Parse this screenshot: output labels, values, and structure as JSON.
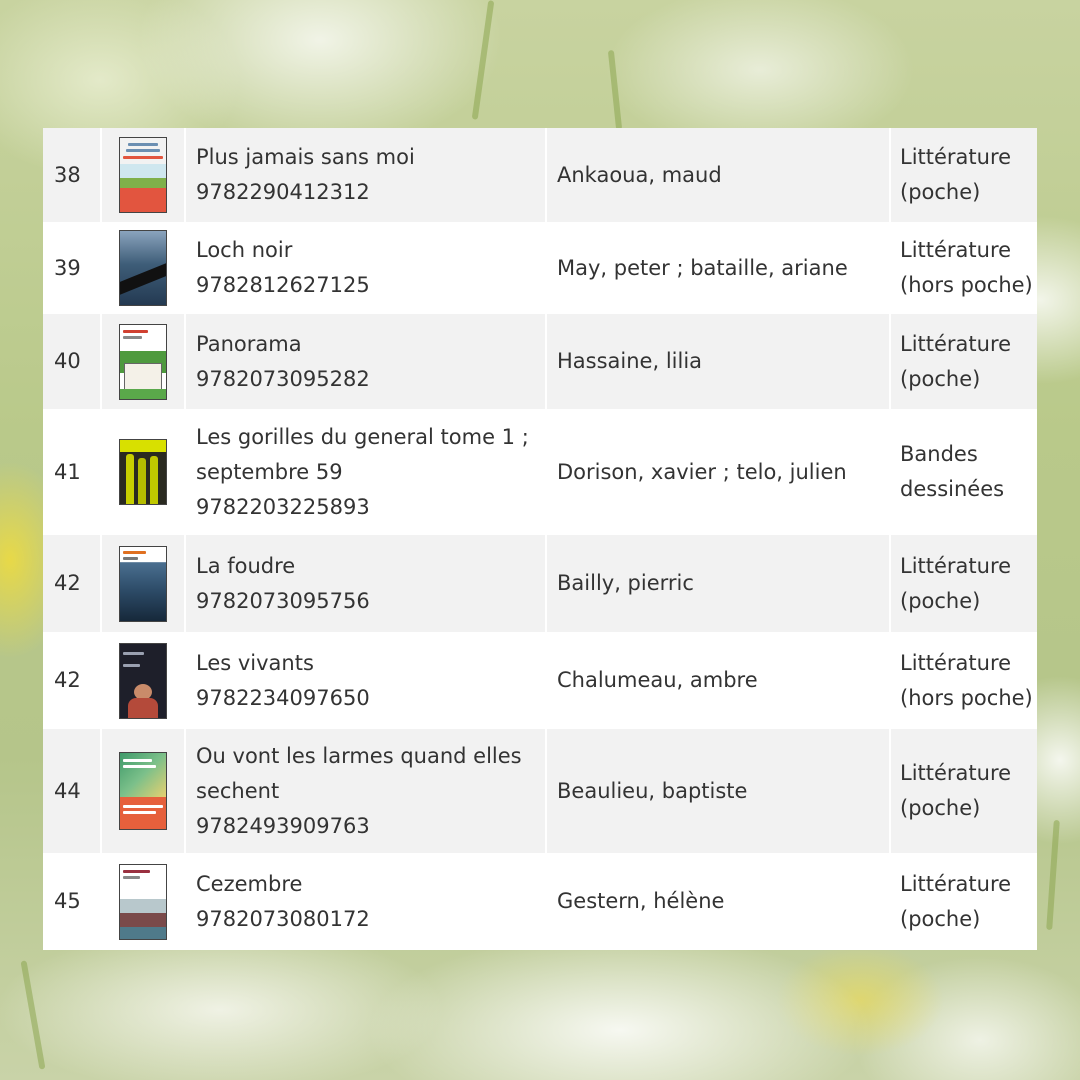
{
  "books": [
    {
      "rank": "38",
      "title": "Plus jamais sans moi",
      "isbn": "9782290412312",
      "author": "Ankaoua, maud",
      "category_line1": "Littérature",
      "category_line2": "(poche)",
      "cover_bg": "#cfe7ef",
      "cover_accent": "#e2553f",
      "cover_top": "#f2f6f3",
      "cover_band": "#7fb04a"
    },
    {
      "rank": "39",
      "title": "Loch noir",
      "isbn": "9782812627125",
      "author": "May, peter ; bataille, ariane",
      "category_line1": "Littérature",
      "category_line2": "(hors poche)",
      "cover_bg": "#3e5d78",
      "cover_accent": "#111111",
      "cover_top": "#8aa3bd",
      "cover_band": "#1a1a1a"
    },
    {
      "rank": "40",
      "title": "Panorama",
      "isbn": "9782073095282",
      "author": "Hassaine, lilia",
      "category_line1": "Littérature",
      "category_line2": "(poche)",
      "cover_bg": "#ffffff",
      "cover_accent": "#3a8a3a",
      "cover_top": "#ffffff",
      "cover_band": "#5aa84a"
    },
    {
      "rank": "41",
      "title_line1": "Les gorilles du general tome 1 ;",
      "title_line2": "septembre 59",
      "isbn": "9782203225893",
      "author": "Dorison, xavier ; telo, julien",
      "category_line1": "Bandes",
      "category_line2": "dessinées",
      "cover_bg": "#2a2a20",
      "cover_accent": "#d8e000",
      "cover_top": "#d8e000",
      "cover_band": "#444433"
    },
    {
      "rank": "42",
      "title": "La foudre",
      "isbn": "9782073095756",
      "author": "Bailly, pierric",
      "category_line1": "Littérature",
      "category_line2": "(poche)",
      "cover_bg": "#2c4a66",
      "cover_accent": "#e07020",
      "cover_top": "#ffffff",
      "cover_band": "#16283a"
    },
    {
      "rank": "42",
      "title": "Les vivants",
      "isbn": "9782234097650",
      "author": "Chalumeau, ambre",
      "category_line1": "Littérature",
      "category_line2": "(hors poche)",
      "cover_bg": "#1e1f2a",
      "cover_accent": "#b44a3a",
      "cover_top": "#1e1f2a",
      "cover_band": "#c98b6a"
    },
    {
      "rank": "44",
      "title_line1": "Ou vont les larmes quand elles",
      "title_line2": "sechent",
      "isbn": "9782493909763",
      "author": "Beaulieu, baptiste",
      "category_line1": "Littérature",
      "category_line2": "(poche)",
      "cover_bg": "#e6603c",
      "cover_accent": "#5fb07a",
      "cover_top": "#3f9a6a",
      "cover_band": "#ffffff"
    },
    {
      "rank": "45",
      "title": "Cezembre",
      "isbn": "9782073080172",
      "author": "Gestern, hélène",
      "category_line1": "Littérature",
      "category_line2": "(poche)",
      "cover_bg": "#ffffff",
      "cover_accent": "#9a3040",
      "cover_top": "#ffffff",
      "cover_band": "#4f7a8a"
    }
  ]
}
